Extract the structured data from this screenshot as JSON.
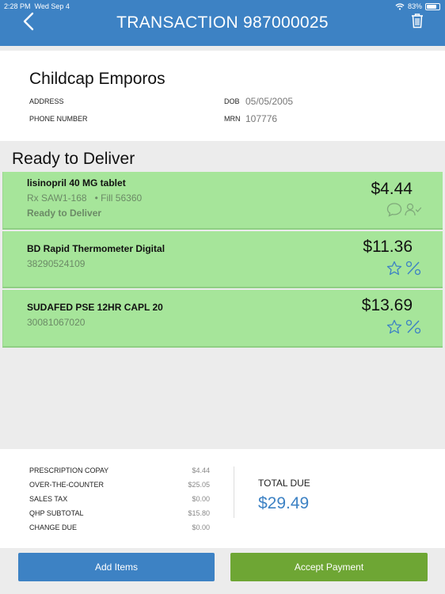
{
  "status_bar": {
    "time": "2:28 PM",
    "date": "Wed Sep 4",
    "battery": "83%",
    "battery_level": 0.83
  },
  "header": {
    "title": "TRANSACTION 987000025"
  },
  "patient": {
    "name": "Childcap Emporos",
    "address_label": "ADDRESS",
    "phone_label": "PHONE NUMBER",
    "dob_label": "DOB",
    "dob_value": "05/05/2005",
    "mrn_label": "MRN",
    "mrn_value": "107776"
  },
  "section": {
    "title": "Ready to Deliver"
  },
  "items": [
    {
      "name": "lisinopril 40 MG tablet",
      "rx": "Rx  SAW1-168",
      "fill": "• Fill  56360",
      "status": "Ready to Deliver",
      "price": "$4.44"
    },
    {
      "name": "BD Rapid Thermometer Digital",
      "code": "38290524109",
      "price": "$11.36"
    },
    {
      "name": "SUDAFED PSE 12HR CAPL 20",
      "code": "30081067020",
      "price": "$13.69"
    }
  ],
  "summary": {
    "rows": [
      {
        "label": "PRESCRIPTION COPAY",
        "value": "$4.44"
      },
      {
        "label": "OVER-THE-COUNTER",
        "value": "$25.05"
      },
      {
        "label": "SALES TAX",
        "value": "$0.00"
      },
      {
        "label": "QHP SUBTOTAL",
        "value": "$15.80"
      },
      {
        "label": "CHANGE DUE",
        "value": "$0.00"
      }
    ],
    "total_label": "TOTAL DUE",
    "total_value": "$29.49"
  },
  "actions": {
    "add_items": "Add Items",
    "accept_payment": "Accept Payment"
  },
  "icons": {
    "back": "chevron-left-icon",
    "delete": "trash-icon",
    "comment": "comment-icon",
    "user_check": "user-check-icon",
    "star": "star-icon",
    "discount": "percent-icon",
    "wifi": "wifi-icon"
  },
  "colors": {
    "header": "#3d82c4",
    "item_background": "#a6e59a",
    "accent_blue": "#3d82c4",
    "accept_green": "#6ea634"
  }
}
